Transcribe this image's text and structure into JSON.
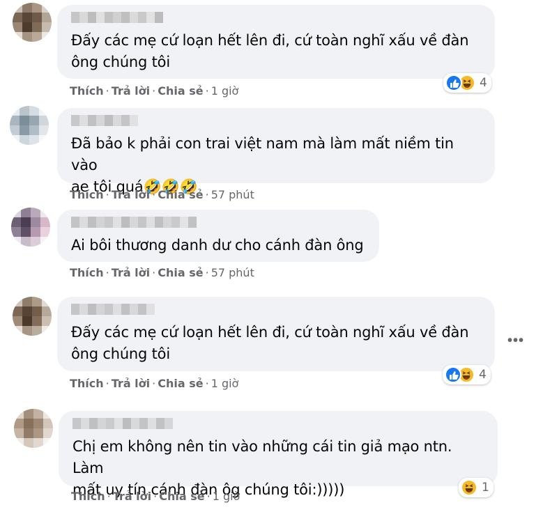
{
  "actions": {
    "like": "Thích",
    "reply": "Trả lời",
    "share": "Chia sẻ",
    "separator": "·"
  },
  "comments": [
    {
      "text_lines": [
        "Đấy các mẹ cứ loạn hết lên đi, cứ toàn nghĩ xấu về đàn",
        "ông chúng tôi"
      ],
      "time": "1 giờ",
      "reactions": [
        "like",
        "haha"
      ],
      "reaction_count": "4"
    },
    {
      "text_lines": [
        "Đã bảo k phải con trai việt nam mà làm mất niềm tin vào",
        "ae tôi quá🤣🤣🤣"
      ],
      "time": "57 phút",
      "reactions": [],
      "reaction_count": ""
    },
    {
      "text_lines": [
        "Ai bôi thương danh dư cho cánh đàn ông"
      ],
      "time": "57 phút",
      "reactions": [],
      "reaction_count": ""
    },
    {
      "text_lines": [
        "Đấy các mẹ cứ loạn hết lên đi, cứ toàn nghĩ xấu về đàn",
        "ông chúng tôi"
      ],
      "time": "1 giờ",
      "reactions": [
        "like",
        "haha"
      ],
      "reaction_count": "4"
    },
    {
      "text_lines": [
        "Chị em không nên tin vào những cái tin giả mạo ntn. Làm",
        "mất uy tín cánh đàn ôg chúng tôi:)))))"
      ],
      "time": "1 giờ",
      "reactions": [
        "haha"
      ],
      "reaction_count": "1"
    }
  ],
  "icons": {
    "more": "more-horizontal-icon",
    "like_reaction": "like-reaction-icon",
    "haha_reaction": "haha-reaction-icon"
  },
  "colors": {
    "bubble": "#f0f2f5",
    "action_text": "#65676b",
    "like_blue": "#1877f2",
    "haha_yellow": "#f7b928"
  }
}
